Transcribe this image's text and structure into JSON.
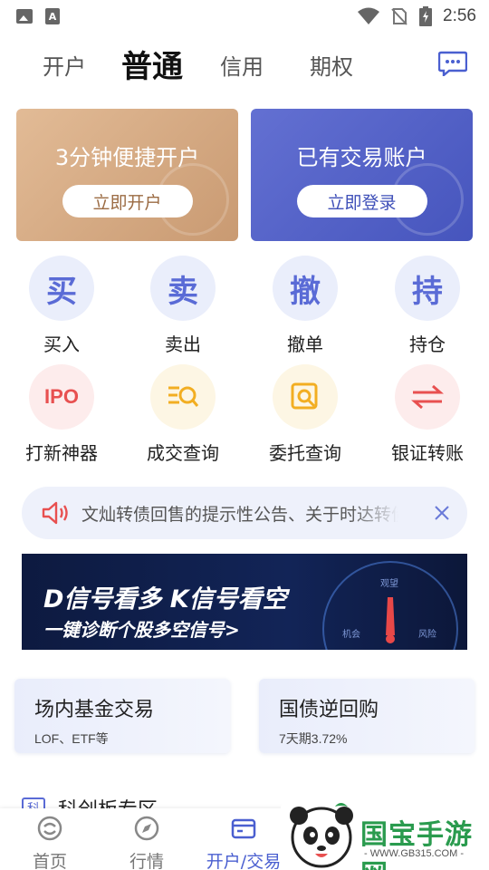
{
  "status_bar": {
    "time": "2:56",
    "a_label": "A"
  },
  "header": {
    "tabs": [
      {
        "label": "开户"
      },
      {
        "label": "普通"
      },
      {
        "label": "信用"
      },
      {
        "label": "期权"
      }
    ],
    "active_tab": "普通"
  },
  "cards": {
    "open": {
      "title": "3分钟便捷开户",
      "button": "立即开户"
    },
    "login": {
      "title": "已有交易账户",
      "button": "立即登录"
    }
  },
  "grid": {
    "row1": [
      {
        "glyph": "买",
        "label": "买入"
      },
      {
        "glyph": "卖",
        "label": "卖出"
      },
      {
        "glyph": "撤",
        "label": "撤单"
      },
      {
        "glyph": "持",
        "label": "持仓"
      }
    ],
    "row2": [
      {
        "glyph": "IPO",
        "label": "打新神器",
        "icon": "ipo-icon"
      },
      {
        "label": "成交查询",
        "icon": "deal-query-icon"
      },
      {
        "label": "委托查询",
        "icon": "order-query-icon"
      },
      {
        "label": "银证转账",
        "icon": "transfer-icon"
      }
    ]
  },
  "notice": {
    "text": "文灿转债回售的提示性公告、关于时达转债"
  },
  "banner": {
    "line1": "D信号看多 K信号看空",
    "line2": "一键诊断个股多空信号>",
    "gauge_labels": {
      "top": "观望",
      "left": "机会",
      "right": "风险"
    }
  },
  "trade_cards": [
    {
      "title": "场内基金交易",
      "subtitle": "LOF、ETF等"
    },
    {
      "title": "国债逆回购",
      "subtitle": "7天期3.72%"
    }
  ],
  "section": {
    "icon_glyph": "科",
    "title": "科创板专区"
  },
  "bottom_nav": [
    {
      "label": "首页"
    },
    {
      "label": "行情"
    },
    {
      "label": "开户/交易"
    }
  ],
  "watermark": {
    "brand": "国宝手游网",
    "url": "- WWW.GB315.COM -"
  },
  "colors": {
    "accent": "#4a5fd0",
    "open_card": "#d4a880",
    "login_card": "#5563c8",
    "red": "#e85050",
    "yellow": "#f2ae22"
  }
}
